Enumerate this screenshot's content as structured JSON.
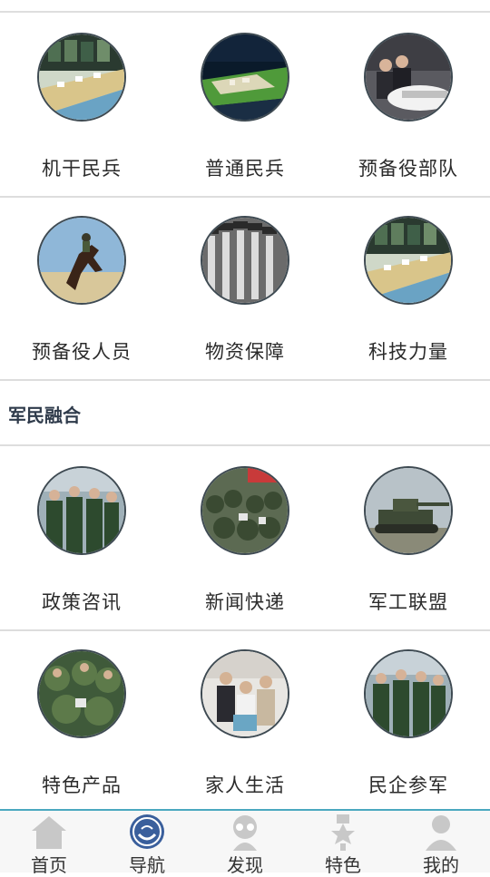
{
  "sections": [
    {
      "rows": [
        [
          {
            "label": "机干民兵",
            "icon": "command-room-photo"
          },
          {
            "label": "普通民兵",
            "icon": "sand-table-photo"
          },
          {
            "label": "预备役部队",
            "icon": "officials-photo"
          }
        ],
        [
          {
            "label": "预备役人员",
            "icon": "horse-rider-photo"
          },
          {
            "label": "物资保障",
            "icon": "soldiers-march-photo"
          },
          {
            "label": "科技力量",
            "icon": "command-room-photo"
          }
        ]
      ]
    },
    {
      "title": "军民融合",
      "rows": [
        [
          {
            "label": "政策咨讯",
            "icon": "officers-group-photo"
          },
          {
            "label": "新闻快递",
            "icon": "crowd-photo"
          },
          {
            "label": "军工联盟",
            "icon": "tank-photo"
          }
        ],
        [
          {
            "label": "特色产品",
            "icon": "camouflage-group-photo"
          },
          {
            "label": "家人生活",
            "icon": "family-photo"
          },
          {
            "label": "民企参军",
            "icon": "officers-group-photo"
          }
        ]
      ]
    }
  ],
  "tabbar": {
    "items": [
      {
        "label": "首页",
        "icon": "home-icon",
        "active": false
      },
      {
        "label": "导航",
        "icon": "navigation-icon",
        "active": true
      },
      {
        "label": "发现",
        "icon": "discover-icon",
        "active": false
      },
      {
        "label": "特色",
        "icon": "medal-icon",
        "active": false
      },
      {
        "label": "我的",
        "icon": "user-icon",
        "active": false
      }
    ]
  },
  "colors": {
    "divider": "#dddddd",
    "tab_border": "#4aa8c0",
    "active_icon": "#3a5f9c",
    "inactive_icon": "#c8c8c8",
    "section_title": "#2f3b4b"
  }
}
